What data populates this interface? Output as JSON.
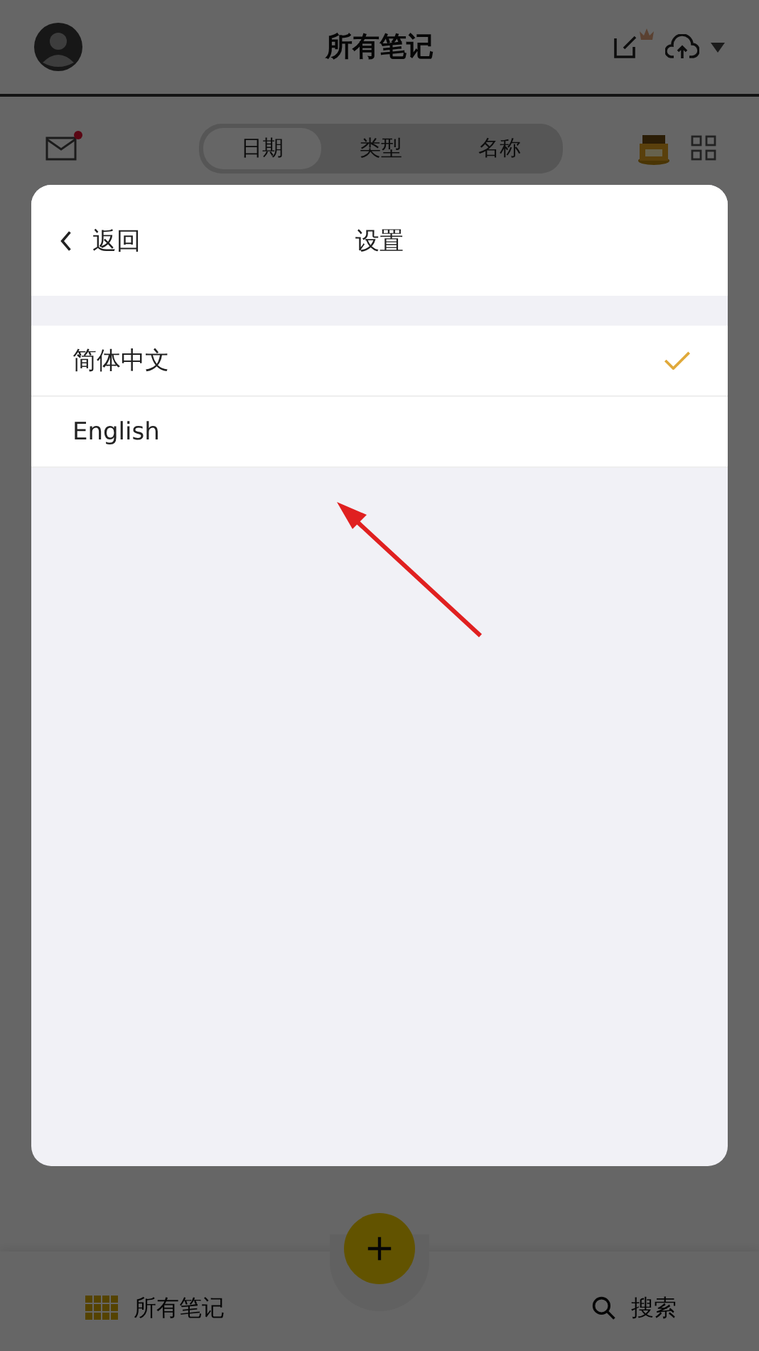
{
  "header": {
    "title": "所有笔记"
  },
  "sort_tabs": [
    {
      "label": "日期",
      "selected": true
    },
    {
      "label": "类型",
      "selected": false
    },
    {
      "label": "名称",
      "selected": false
    }
  ],
  "mail": {
    "unread": true
  },
  "dialog": {
    "back": "返回",
    "title": "设置",
    "languages": [
      {
        "label": "简体中文",
        "selected": true
      },
      {
        "label": "English",
        "selected": false
      }
    ]
  },
  "bottom_bar": {
    "notes": "所有笔记",
    "search": "搜索"
  }
}
